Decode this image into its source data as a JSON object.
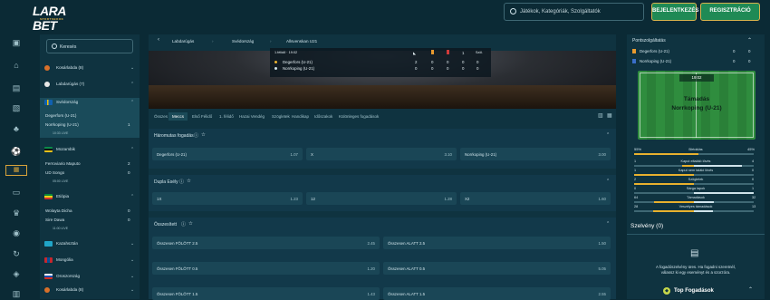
{
  "header": {
    "logo": "LARA BET",
    "logo_sub": "SPORTSBOOK",
    "search_placeholder": "Játékok, Kategóriák, Szolgáltatók",
    "login_label": "BEJELENTKEZÉS",
    "register_label": "REGISZTRÁCIÓ"
  },
  "rail": {
    "icons": [
      "gift-icon",
      "home-icon",
      "coupon-icon",
      "dice-icon",
      "cards-icon",
      "football-icon",
      "live-icon",
      "screen-icon",
      "trophy-icon",
      "chip-icon",
      "history-icon",
      "chart-icon",
      "briefcase-icon"
    ]
  },
  "sidebar": {
    "search_placeholder": "Keresés",
    "items": [
      {
        "label": "Kosárlabda (8)",
        "type": "sport"
      },
      {
        "label": "Labdarúgás (7)",
        "type": "sport"
      },
      {
        "label": "Svédország",
        "type": "country",
        "flag": "se"
      },
      {
        "label": "Degerfors (U-21)",
        "type": "team"
      },
      {
        "label": "Norrkoping (U-21)",
        "type": "team",
        "count": "1"
      },
      {
        "label": "10:33 LIVE",
        "type": "time"
      },
      {
        "label": "Mozambik",
        "type": "country",
        "flag": "mz"
      },
      {
        "label": "Ferroviario Maputo",
        "type": "team",
        "count": "2"
      },
      {
        "label": "UD Songo",
        "type": "team",
        "count": "0"
      },
      {
        "label": "05:00 LIVE",
        "type": "time"
      },
      {
        "label": "Etiópia",
        "type": "country",
        "flag": "et"
      },
      {
        "label": "Wolayta Dicha",
        "type": "team",
        "count": "0"
      },
      {
        "label": "Sire Dawa",
        "type": "team",
        "count": "0"
      },
      {
        "label": "11:00 LIVE",
        "type": "time"
      },
      {
        "label": "Kazahsztán",
        "type": "country",
        "flag": "kz"
      },
      {
        "label": "Mongólia",
        "type": "country",
        "flag": "mn"
      },
      {
        "label": "Oroszország",
        "type": "country",
        "flag": "ru"
      },
      {
        "label": "Kosárlabda (8)",
        "type": "sport"
      }
    ]
  },
  "breadcrumb": [
    "Labdarúgás",
    "Svédország",
    "Allsvenskan U21"
  ],
  "match": {
    "status": "1.félidő · 19:02",
    "home": "Degerfors (U-21)",
    "away": "Norrkoping (U-21)",
    "home_scores": [
      "2",
      "0",
      "0",
      "0",
      "0"
    ],
    "away_scores": [
      "0",
      "0",
      "0",
      "0",
      "0"
    ],
    "col_labels": [
      "1",
      "Szöl."
    ]
  },
  "tabs": [
    "Összes",
    "Meccs",
    "Első Félidő",
    "1. félidő",
    "Hazai Vendég",
    "Szögletek",
    "Handikap",
    "Időszakok",
    "Különleges fogadások"
  ],
  "markets": [
    {
      "title": "Háromutas fogadás",
      "cells": [
        {
          "name": "Degerfors (U-21)",
          "odd": "1.07"
        },
        {
          "name": "X",
          "odd": "3.10"
        },
        {
          "name": "Norrkoping (U-21)",
          "odd": "3.00"
        }
      ]
    },
    {
      "title": "Dupla Esély",
      "cells": [
        {
          "name": "1X",
          "odd": "1.23"
        },
        {
          "name": "12",
          "odd": "1.28"
        },
        {
          "name": "X2",
          "odd": "1.60"
        }
      ]
    },
    {
      "title": "Összesített",
      "cells": [
        {
          "name": "Összesen FÖLÖTT 2.5",
          "odd": "2.45"
        },
        {
          "name": "Összesen ALATT 2.5",
          "odd": "1.50"
        },
        {
          "name": "Összesen FÖLÖTT 0.5",
          "odd": "1.20"
        },
        {
          "name": "Összesen ALATT 0.5",
          "odd": "5.05"
        },
        {
          "name": "Összesen FÖLÖTT 1.5",
          "odd": "1.43"
        },
        {
          "name": "Összesen ALATT 1.5",
          "odd": "2.55"
        }
      ]
    }
  ],
  "right_panel": {
    "title": "Pontszolgáltatás",
    "team1": "Degerfors (U-21)",
    "team2": "Norrkoping (U-21)",
    "team1_vals": [
      "0",
      "0"
    ],
    "team2_vals": [
      "0",
      "0"
    ],
    "pitch_time": "19:02",
    "pitch_text1": "Támadás",
    "pitch_text2": "Norrkoping (U-21)",
    "possession_left": "55%",
    "possession_label": "Birtoklás",
    "possession_right": "45%",
    "stats": [
      {
        "label": "Kaput eltaláló lövés",
        "left": "1",
        "right": "4",
        "lf": 0.2,
        "rf": 0.8
      },
      {
        "label": "Kaput nem találó lövés",
        "left": "1",
        "right": "0",
        "lf": 1.0,
        "rf": 0.0
      },
      {
        "label": "Szögletek",
        "left": "2",
        "right": "0",
        "lf": 1.0,
        "rf": 0.0
      },
      {
        "label": "Sárga lapok",
        "left": "0",
        "right": "1",
        "lf": 0.0,
        "rf": 1.0
      },
      {
        "label": "Támadások",
        "left": "64",
        "right": "32",
        "lf": 0.67,
        "rf": 0.33
      },
      {
        "label": "Veszélyes támadások",
        "left": "28",
        "right": "13",
        "lf": 0.68,
        "rf": 0.32
      }
    ],
    "betslip_title": "Szelvény (0)",
    "betslip_text1": "A fogadószelvény üres. Ha fogadni szeretnél,",
    "betslip_text2": "válassz ki egy eseményt és a szorzóra.",
    "top_bets": "Top Fogadások"
  }
}
